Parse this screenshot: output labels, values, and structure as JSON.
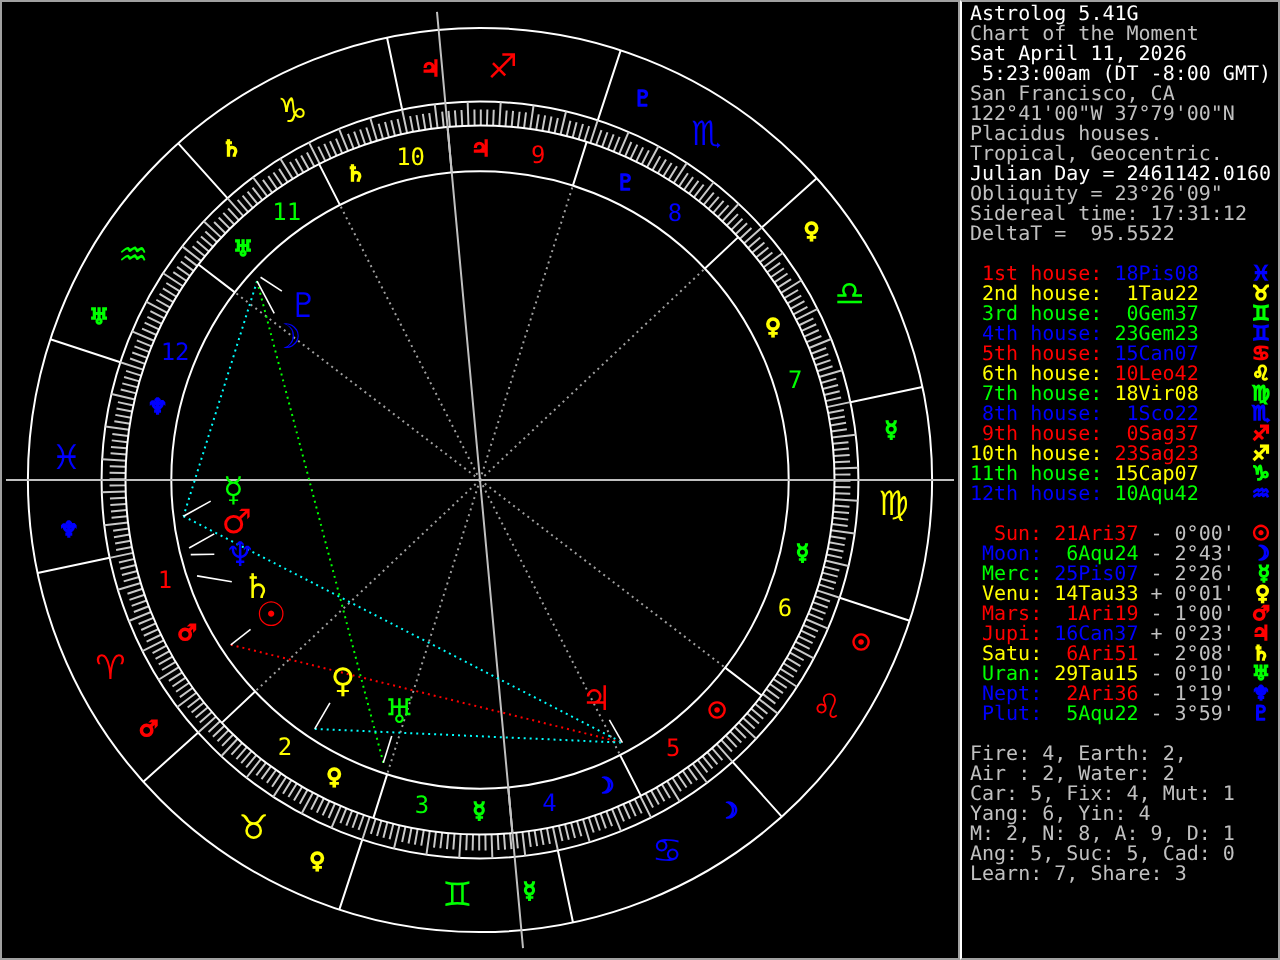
{
  "chart": {
    "signs": [
      {
        "glyph": "♈",
        "color": "#ff0000",
        "ruler": {
          "glyph": "♂",
          "color": "#ff0000"
        }
      },
      {
        "glyph": "♉",
        "color": "#ffff00",
        "ruler": {
          "glyph": "♀",
          "color": "#ffff00"
        }
      },
      {
        "glyph": "♊",
        "color": "#00ff00",
        "ruler": {
          "glyph": "☿",
          "color": "#00ff00"
        }
      },
      {
        "glyph": "♋",
        "color": "#0000ff",
        "ruler": {
          "glyph": "☽",
          "color": "#0000ff"
        }
      },
      {
        "glyph": "♌",
        "color": "#ff0000",
        "ruler": {
          "glyph": "☉",
          "color": "#ff0000"
        }
      },
      {
        "glyph": "♍",
        "color": "#ffff00",
        "ruler": {
          "glyph": "☿",
          "color": "#00ff00"
        }
      },
      {
        "glyph": "♎",
        "color": "#00ff00",
        "ruler": {
          "glyph": "♀",
          "color": "#ffff00"
        }
      },
      {
        "glyph": "♏",
        "color": "#0000ff",
        "ruler": {
          "glyph": "♇",
          "color": "#0000ff"
        }
      },
      {
        "glyph": "♐",
        "color": "#ff0000",
        "ruler": {
          "glyph": "♃",
          "color": "#ff0000"
        }
      },
      {
        "glyph": "♑",
        "color": "#ffff00",
        "ruler": {
          "glyph": "♄",
          "color": "#ffff00"
        }
      },
      {
        "glyph": "♒",
        "color": "#00ff00",
        "ruler": {
          "glyph": "♅",
          "color": "#00ff00"
        }
      },
      {
        "glyph": "♓",
        "color": "#0000ff",
        "ruler": {
          "glyph": "♆",
          "color": "#0000ff"
        }
      }
    ],
    "houses": [
      {
        "number": "1",
        "color": "#ff0000",
        "ruler": {
          "glyph": "♂",
          "color": "#ff0000"
        }
      },
      {
        "number": "2",
        "color": "#ffff00",
        "ruler": {
          "glyph": "♀",
          "color": "#ffff00"
        }
      },
      {
        "number": "3",
        "color": "#00ff00",
        "ruler": {
          "glyph": "☿",
          "color": "#00ff00"
        }
      },
      {
        "number": "4",
        "color": "#0000ff",
        "ruler": {
          "glyph": "☽",
          "color": "#0000ff"
        }
      },
      {
        "number": "5",
        "color": "#ff0000",
        "ruler": {
          "glyph": "☉",
          "color": "#ff0000"
        }
      },
      {
        "number": "6",
        "color": "#ffff00",
        "ruler": {
          "glyph": "☿",
          "color": "#00ff00"
        }
      },
      {
        "number": "7",
        "color": "#00ff00",
        "ruler": {
          "glyph": "♀",
          "color": "#ffff00"
        }
      },
      {
        "number": "8",
        "color": "#0000ff",
        "ruler": {
          "glyph": "♇",
          "color": "#0000ff"
        }
      },
      {
        "number": "9",
        "color": "#ff0000",
        "ruler": {
          "glyph": "♃",
          "color": "#ff0000"
        }
      },
      {
        "number": "10",
        "color": "#ffff00",
        "ruler": {
          "glyph": "♄",
          "color": "#ffff00"
        }
      },
      {
        "number": "11",
        "color": "#00ff00",
        "ruler": {
          "glyph": "♅",
          "color": "#00ff00"
        }
      },
      {
        "number": "12",
        "color": "#0000ff",
        "ruler": {
          "glyph": "♆",
          "color": "#0000ff"
        }
      }
    ],
    "planets": [
      {
        "glyph": "☉",
        "color": "#ff0000"
      },
      {
        "glyph": "☽",
        "color": "#0000ff"
      },
      {
        "glyph": "☿",
        "color": "#00ff00"
      },
      {
        "glyph": "♀",
        "color": "#ffff00"
      },
      {
        "glyph": "♂",
        "color": "#ff0000"
      },
      {
        "glyph": "♃",
        "color": "#ff0000"
      },
      {
        "glyph": "♄",
        "color": "#ffff00"
      },
      {
        "glyph": "♅",
        "color": "#00ff00"
      },
      {
        "glyph": "♆",
        "color": "#0000ff"
      },
      {
        "glyph": "♇",
        "color": "#0000ff"
      }
    ]
  },
  "header": [
    {
      "text": "Astrolog 5.41G",
      "bright": true
    },
    {
      "text": "Chart of the Moment",
      "bright": false
    },
    {
      "text": "Sat April 11, 2026",
      "bright": true
    },
    {
      "text": " 5:23:00am (DT -8:00 GMT)",
      "bright": true
    },
    {
      "text": "San Francisco, CA",
      "bright": false
    },
    {
      "text": "122°41'00\"W 37°79'00\"N",
      "bright": false
    },
    {
      "text": "Placidus houses.",
      "bright": false
    },
    {
      "text": "Tropical, Geocentric.",
      "bright": false
    },
    {
      "text": "Julian Day = 2461142.0160",
      "bright": true
    },
    {
      "text": "Obliquity = 23°26'09\"",
      "bright": false
    },
    {
      "text": "Sidereal time: 17:31:12",
      "bright": false
    },
    {
      "text": "DeltaT =  95.5522",
      "bright": false
    }
  ],
  "house_cusps": [
    {
      "label": {
        "text": "1st house:",
        "color": "#ff0000"
      },
      "position": {
        "text": "18Pis08",
        "color": "#0000ff"
      },
      "sign": {
        "glyph": "♓",
        "color": "#0000ff"
      }
    },
    {
      "label": {
        "text": "2nd house:",
        "color": "#ffff00"
      },
      "position": {
        "text": "1Tau22",
        "color": "#ffff00"
      },
      "sign": {
        "glyph": "♉",
        "color": "#ffff00"
      }
    },
    {
      "label": {
        "text": "3rd house:",
        "color": "#00ff00"
      },
      "position": {
        "text": "0Gem37",
        "color": "#00ff00"
      },
      "sign": {
        "glyph": "♊",
        "color": "#00ff00"
      }
    },
    {
      "label": {
        "text": "4th house:",
        "color": "#0000ff"
      },
      "position": {
        "text": "23Gem23",
        "color": "#00ff00"
      },
      "sign": {
        "glyph": "♊",
        "color": "#0000ff"
      }
    },
    {
      "label": {
        "text": "5th house:",
        "color": "#ff0000"
      },
      "position": {
        "text": "15Can07",
        "color": "#0000ff"
      },
      "sign": {
        "glyph": "♋",
        "color": "#ff0000"
      }
    },
    {
      "label": {
        "text": "6th house:",
        "color": "#ffff00"
      },
      "position": {
        "text": "10Leo42",
        "color": "#ff0000"
      },
      "sign": {
        "glyph": "♌",
        "color": "#ffff00"
      }
    },
    {
      "label": {
        "text": "7th house:",
        "color": "#00ff00"
      },
      "position": {
        "text": "18Vir08",
        "color": "#ffff00"
      },
      "sign": {
        "glyph": "♍",
        "color": "#00ff00"
      }
    },
    {
      "label": {
        "text": "8th house:",
        "color": "#0000ff"
      },
      "position": {
        "text": "1Sco22",
        "color": "#0000ff"
      },
      "sign": {
        "glyph": "♏",
        "color": "#0000ff"
      }
    },
    {
      "label": {
        "text": "9th house:",
        "color": "#ff0000"
      },
      "position": {
        "text": "0Sag37",
        "color": "#ff0000"
      },
      "sign": {
        "glyph": "♐",
        "color": "#ff0000"
      }
    },
    {
      "label": {
        "text": "10th house:",
        "color": "#ffff00"
      },
      "position": {
        "text": "23Sag23",
        "color": "#ff0000"
      },
      "sign": {
        "glyph": "♐",
        "color": "#ffff00"
      }
    },
    {
      "label": {
        "text": "11th house:",
        "color": "#00ff00"
      },
      "position": {
        "text": "15Cap07",
        "color": "#ffff00"
      },
      "sign": {
        "glyph": "♑",
        "color": "#00ff00"
      }
    },
    {
      "label": {
        "text": "12th house:",
        "color": "#0000ff"
      },
      "position": {
        "text": "10Aqu42",
        "color": "#00ff00"
      },
      "sign": {
        "glyph": "♒",
        "color": "#0000ff"
      }
    }
  ],
  "planet_positions": [
    {
      "name": {
        "text": "Sun:",
        "color": "#ff0000"
      },
      "position": {
        "text": "21Ari37",
        "color": "#ff0000"
      },
      "latitude": "- 0°00'",
      "glyph": {
        "text": "☉",
        "color": "#ff0000"
      }
    },
    {
      "name": {
        "text": "Moon:",
        "color": "#0000ff"
      },
      "position": {
        "text": "6Aqu24",
        "color": "#00ff00"
      },
      "latitude": "- 2°43'",
      "glyph": {
        "text": "☽",
        "color": "#0000ff"
      }
    },
    {
      "name": {
        "text": "Merc:",
        "color": "#00ff00"
      },
      "position": {
        "text": "25Pis07",
        "color": "#0000ff"
      },
      "latitude": "- 2°26'",
      "glyph": {
        "text": "☿",
        "color": "#00ff00"
      }
    },
    {
      "name": {
        "text": "Venu:",
        "color": "#ffff00"
      },
      "position": {
        "text": "14Tau33",
        "color": "#ffff00"
      },
      "latitude": "+ 0°01'",
      "glyph": {
        "text": "♀",
        "color": "#ffff00"
      }
    },
    {
      "name": {
        "text": "Mars:",
        "color": "#ff0000"
      },
      "position": {
        "text": "1Ari19",
        "color": "#ff0000"
      },
      "latitude": "- 1°00'",
      "glyph": {
        "text": "♂",
        "color": "#ff0000"
      }
    },
    {
      "name": {
        "text": "Jupi:",
        "color": "#ff0000"
      },
      "position": {
        "text": "16Can37",
        "color": "#0000ff"
      },
      "latitude": "+ 0°23'",
      "glyph": {
        "text": "♃",
        "color": "#ff0000"
      }
    },
    {
      "name": {
        "text": "Satu:",
        "color": "#ffff00"
      },
      "position": {
        "text": "6Ari51",
        "color": "#ff0000"
      },
      "latitude": "- 2°08'",
      "glyph": {
        "text": "♄",
        "color": "#ffff00"
      }
    },
    {
      "name": {
        "text": "Uran:",
        "color": "#00ff00"
      },
      "position": {
        "text": "29Tau15",
        "color": "#ffff00"
      },
      "latitude": "- 0°10'",
      "glyph": {
        "text": "♅",
        "color": "#00ff00"
      }
    },
    {
      "name": {
        "text": "Nept:",
        "color": "#0000ff"
      },
      "position": {
        "text": "2Ari36",
        "color": "#ff0000"
      },
      "latitude": "- 1°19'",
      "glyph": {
        "text": "♆",
        "color": "#0000ff"
      }
    },
    {
      "name": {
        "text": "Plut:",
        "color": "#0000ff"
      },
      "position": {
        "text": "5Aqu22",
        "color": "#00ff00"
      },
      "latitude": "- 3°59'",
      "glyph": {
        "text": "♇",
        "color": "#0000ff"
      }
    }
  ],
  "summary": [
    "Fire: 4, Earth: 2,",
    "Air : 2, Water: 2",
    "Car: 5, Fix: 4, Mut: 1",
    "Yang: 6, Yin: 4",
    "M: 2, N: 8, A: 9, D: 1",
    "Ang: 5, Suc: 5, Cad: 0",
    "Learn: 7, Share: 3"
  ]
}
